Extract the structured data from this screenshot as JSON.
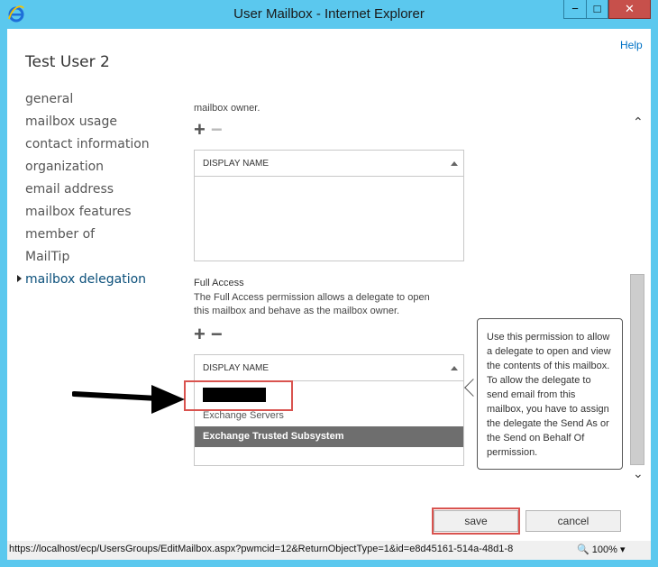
{
  "window": {
    "title": "User Mailbox - Internet Explorer",
    "min_glyph": "−",
    "max_glyph": "□",
    "close_glyph": "✕"
  },
  "header": {
    "help_label": "Help",
    "user_name": "Test User 2"
  },
  "nav": {
    "items": [
      {
        "label": "general"
      },
      {
        "label": "mailbox usage"
      },
      {
        "label": "contact information"
      },
      {
        "label": "organization"
      },
      {
        "label": "email address"
      },
      {
        "label": "mailbox features"
      },
      {
        "label": "member of"
      },
      {
        "label": "MailTip"
      },
      {
        "label": "mailbox delegation"
      }
    ],
    "active_index": 8
  },
  "send_on_behalf": {
    "text_fragment": "mailbox owner.",
    "add_glyph": "+",
    "remove_glyph": "−",
    "column_header": "DISPLAY NAME"
  },
  "full_access": {
    "title": "Full Access",
    "description_line1": "The Full Access permission allows a delegate to open",
    "description_line2": "this mailbox and behave as the mailbox owner.",
    "add_glyph": "+",
    "remove_glyph": "−",
    "column_header": "DISPLAY NAME",
    "rows": [
      {
        "label": "",
        "redacted": true
      },
      {
        "label": "Exchange Servers"
      },
      {
        "label": "Exchange Trusted Subsystem",
        "selected": true
      }
    ]
  },
  "tooltip": {
    "text": "Use this permission to allow a delegate to open and view the contents of this mailbox. To allow the delegate to send email from this mailbox, you have to assign the delegate the Send As or the Send on Behalf Of permission."
  },
  "buttons": {
    "save_label": "save",
    "cancel_label": "cancel"
  },
  "statusbar": {
    "url": "https://localhost/ecp/UsersGroups/EditMailbox.aspx?pwmcid=12&ReturnObjectType=1&id=e8d45161-514a-48d1-8",
    "zoom": "100%"
  },
  "colors": {
    "frame": "#5bc8ee",
    "accent_link": "#0072c6",
    "highlight": "#d9534f",
    "selected_row": "#6e6e6e"
  },
  "icons": [
    "ie-logo-icon",
    "add-icon",
    "remove-icon",
    "sort-arrow-icon",
    "scroll-up-icon",
    "scroll-down-icon",
    "zoom-icon",
    "annotation-arrow"
  ]
}
